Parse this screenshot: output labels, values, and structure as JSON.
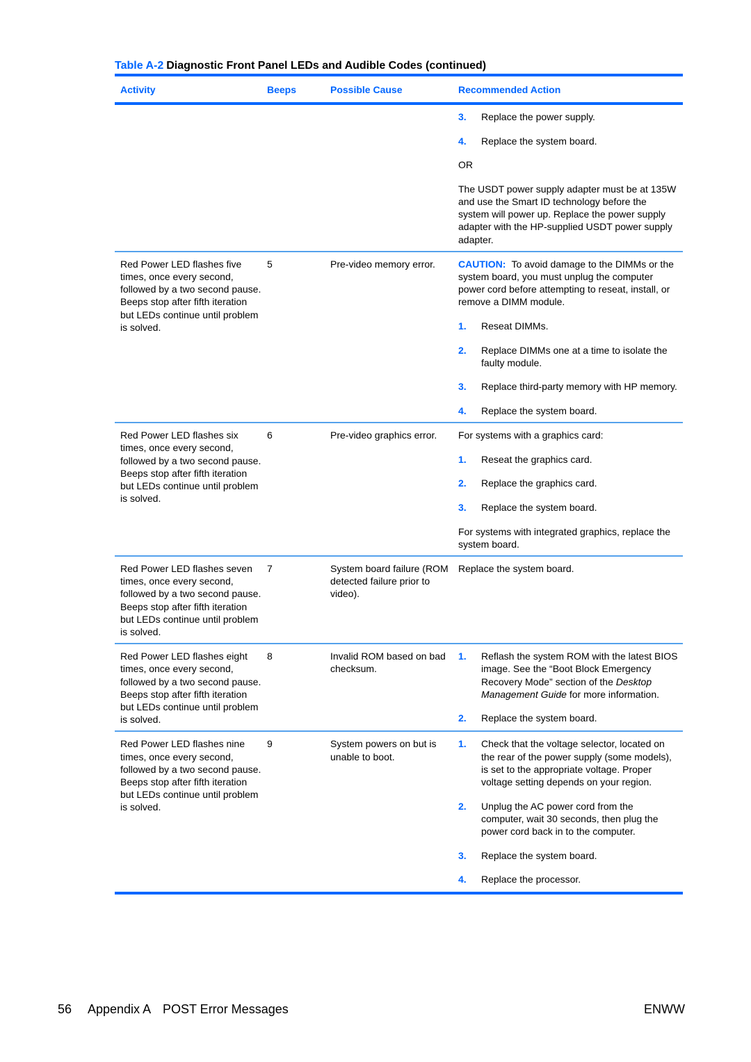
{
  "table": {
    "label": "Table A-2",
    "title": "Diagnostic Front Panel LEDs and Audible Codes (continued)",
    "columns": [
      "Activity",
      "Beeps",
      "Possible Cause",
      "Recommended Action"
    ],
    "rows": [
      {
        "activity": "",
        "beeps": "",
        "cause": "",
        "action": {
          "steps_a": [
            {
              "num": "3.",
              "text": "Replace the power supply."
            },
            {
              "num": "4.",
              "text": "Replace the system board."
            }
          ],
          "or": "OR",
          "note": "The USDT power supply adapter must be at 135W and use the Smart ID technology before the system will power up. Replace the power supply adapter with the HP-supplied USDT power supply adapter."
        }
      },
      {
        "activity": "Red Power LED flashes five times, once every second, followed by a two second pause. Beeps stop after fifth iteration but LEDs continue until problem is solved.",
        "beeps": "5",
        "cause": "Pre-video memory error.",
        "action": {
          "caution_label": "CAUTION:",
          "caution_text": "To avoid damage to the DIMMs or the system board, you must unplug the computer power cord before attempting to reseat, install, or remove a DIMM module.",
          "steps": [
            {
              "num": "1.",
              "text": "Reseat DIMMs."
            },
            {
              "num": "2.",
              "text": "Replace DIMMs one at a time to isolate the faulty module."
            },
            {
              "num": "3.",
              "text": "Replace third-party memory with HP memory."
            },
            {
              "num": "4.",
              "text": "Replace the system board."
            }
          ]
        }
      },
      {
        "activity": "Red Power LED flashes six times, once every second, followed by a two second pause. Beeps stop after fifth iteration but LEDs continue until problem is solved.",
        "beeps": "6",
        "cause": "Pre-video graphics error.",
        "action": {
          "intro": "For systems with a graphics card:",
          "steps": [
            {
              "num": "1.",
              "text": "Reseat the graphics card."
            },
            {
              "num": "2.",
              "text": "Replace the graphics card."
            },
            {
              "num": "3.",
              "text": "Replace the system board."
            }
          ],
          "outro": "For systems with integrated graphics, replace the system board."
        }
      },
      {
        "activity": "Red Power LED flashes seven times, once every second, followed by a two second pause. Beeps stop after fifth iteration but LEDs continue until problem is solved.",
        "beeps": "7",
        "cause": "System board failure (ROM detected failure prior to video).",
        "action": {
          "text": "Replace the system board."
        }
      },
      {
        "activity": "Red Power LED flashes eight times, once every second, followed by a two second pause. Beeps stop after fifth iteration but LEDs continue until problem is solved.",
        "beeps": "8",
        "cause": "Invalid ROM based on bad checksum.",
        "action": {
          "step1_num": "1.",
          "step1_text_a": "Reflash the system ROM with the latest BIOS image. See the “Boot Block Emergency Recovery Mode” section of the ",
          "step1_text_italic": "Desktop Management Guide",
          "step1_text_b": " for more information.",
          "step2_num": "2.",
          "step2_text": "Replace the system board."
        }
      },
      {
        "activity": "Red Power LED flashes nine times, once every second, followed by a two second pause. Beeps stop after fifth iteration but LEDs continue until problem is solved.",
        "beeps": "9",
        "cause": "System powers on but is unable to boot.",
        "action": {
          "steps": [
            {
              "num": "1.",
              "text": "Check that the voltage selector, located on the rear of the power supply (some models), is set to the appropriate voltage. Proper voltage setting depends on your region."
            },
            {
              "num": "2.",
              "text": "Unplug the AC power cord from the computer, wait 30 seconds, then plug the power cord back in to the computer."
            },
            {
              "num": "3.",
              "text": "Replace the system board."
            },
            {
              "num": "4.",
              "text": "Replace the processor."
            }
          ]
        }
      }
    ]
  },
  "footer": {
    "page_number": "56",
    "section": "Appendix A",
    "section_title": "POST Error Messages",
    "locale": "ENWW"
  },
  "colors": {
    "accent": "#0066ff",
    "thin_rule": "#5fa8ef"
  }
}
